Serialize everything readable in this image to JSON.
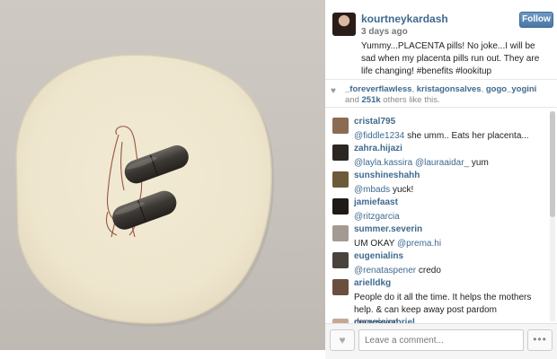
{
  "post": {
    "username": "kourtneykardash",
    "time_ago": "3 days ago",
    "follow_label": "Follow",
    "caption": "Yummy...PLACENTA pills! No joke...I will be sad when my placenta pills run out. They are life changing! #benefits #lookitup"
  },
  "likes": {
    "user1": "_foreverflawless",
    "sep1": ", ",
    "user2": "kristagonsalves",
    "sep2": ", ",
    "user3": "gogo_yogini",
    "and_text": " and ",
    "count": "251k",
    "suffix": " others like this."
  },
  "comments": [
    {
      "user": "cristal795",
      "mention": "@fiddle1234",
      "text": " she umm.. Eats her placenta..."
    },
    {
      "user": "zahra.hijazi",
      "mention": "@layla.kassira @lauraaidar_",
      "text": " yum"
    },
    {
      "user": "sunshineshahh",
      "mention": "@mbads",
      "text": " yuck!"
    },
    {
      "user": "jamiefaast",
      "mention": "@ritzgarcia",
      "text": ""
    },
    {
      "user": "summer.severin",
      "mention": "",
      "text": "UM OKAY ",
      "mention_after": "@prema.hi"
    },
    {
      "user": "eugenialins",
      "mention": "@renataspener",
      "text": " credo"
    },
    {
      "user": "arielldkg",
      "mention": "",
      "text": "People do it all the time. It helps the mothers help. & can keep away post pardom depression."
    },
    {
      "user": "maggiegabriel",
      "mention": "",
      "text": ""
    }
  ],
  "footer": {
    "comment_placeholder": "Leave a comment...",
    "like_icon": "heart-icon",
    "more_icon": "ellipsis-icon",
    "more_label": "•••"
  },
  "colors": {
    "username_blue": "#3f6a8f",
    "follow_blue": "#4a77a5"
  }
}
